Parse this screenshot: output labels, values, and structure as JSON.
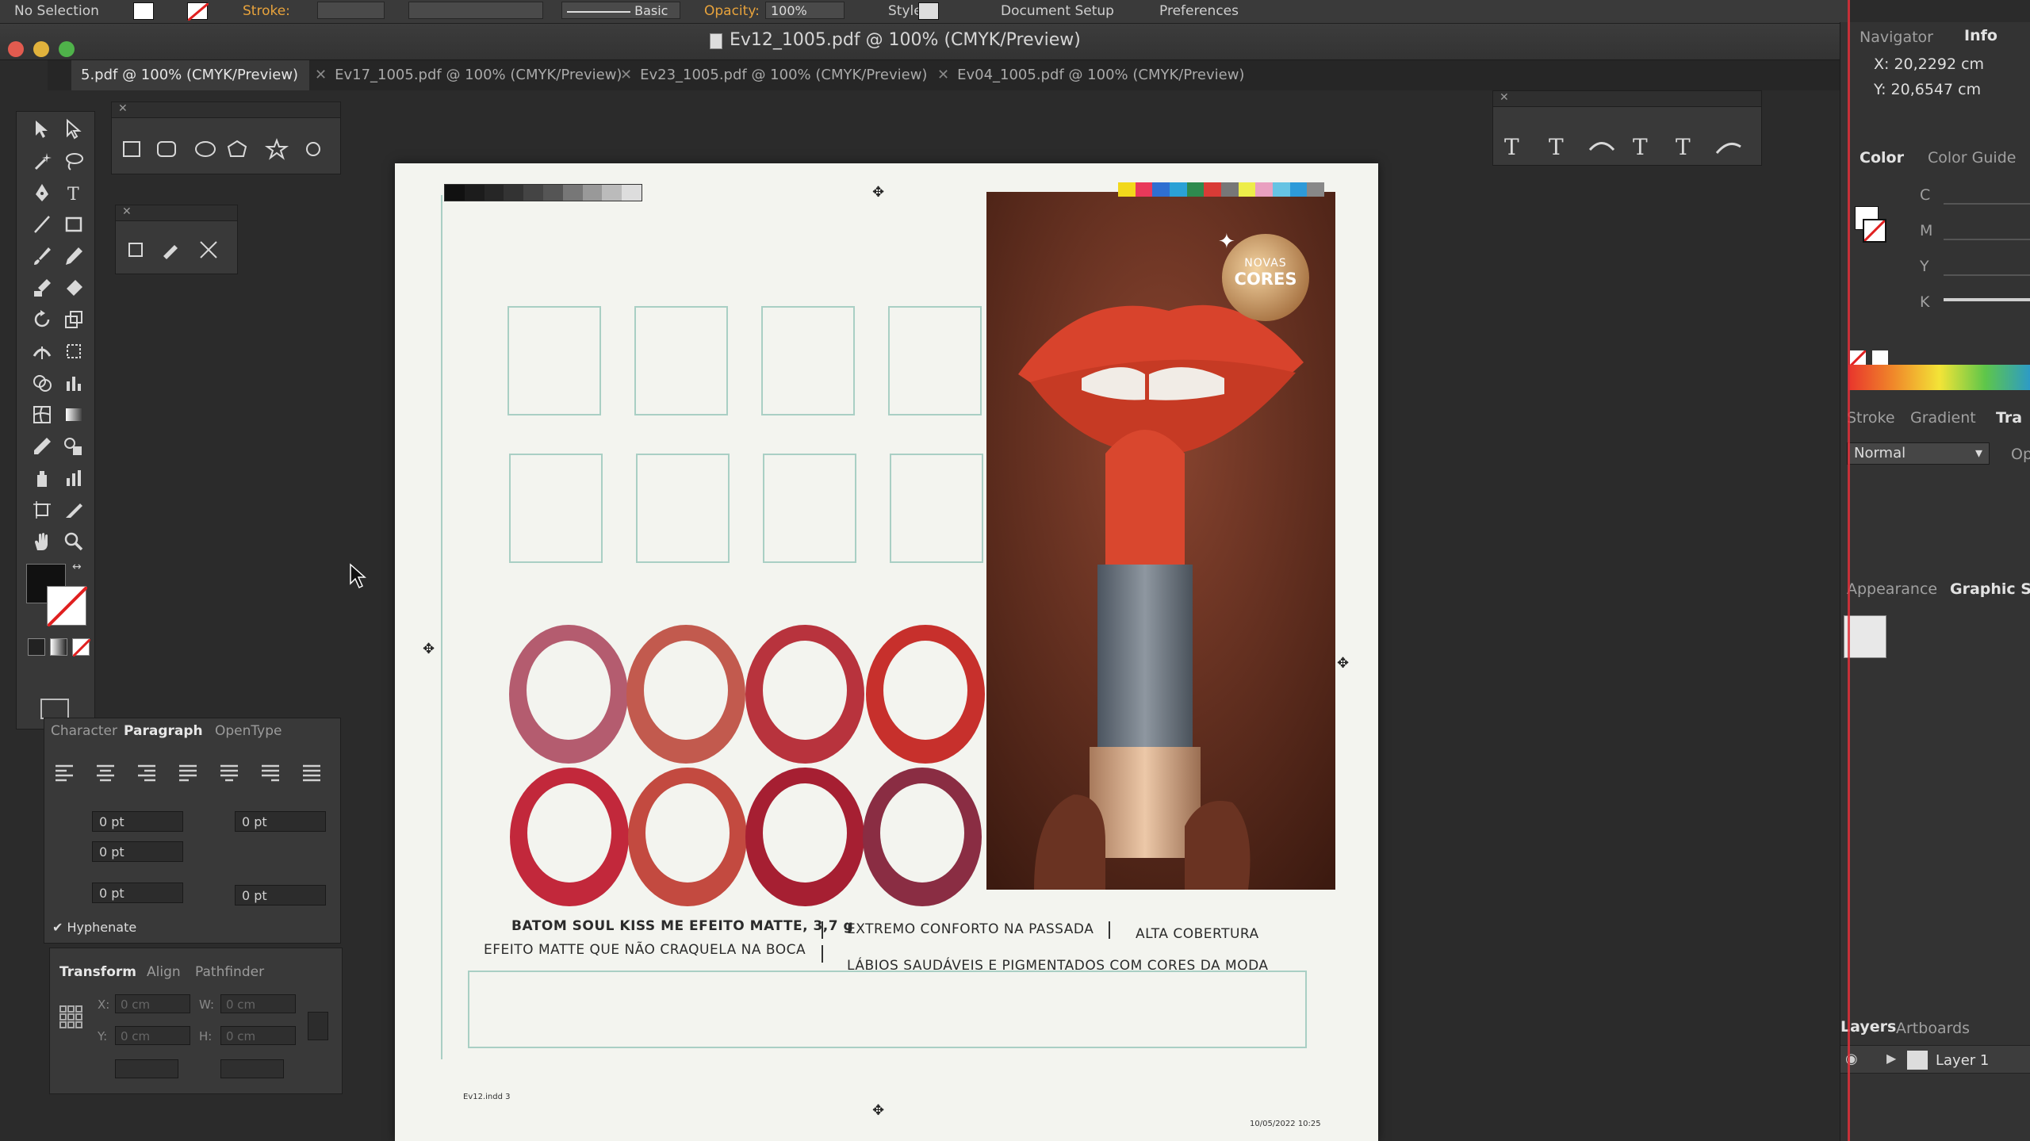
{
  "control_bar": {
    "selection": "No Selection",
    "stroke_label": "Stroke:",
    "brush": "Basic",
    "opacity_label": "Opacity:",
    "opacity_value": "100%",
    "style_label": "Style:",
    "document_setup": "Document Setup",
    "preferences": "Preferences"
  },
  "window": {
    "title": "Ev12_1005.pdf @ 100% (CMYK/Preview)"
  },
  "tabs": [
    {
      "label": "5.pdf @ 100% (CMYK/Preview)",
      "active": true
    },
    {
      "label": "Ev17_1005.pdf @ 100% (CMYK/Preview)",
      "active": false
    },
    {
      "label": "Ev23_1005.pdf @ 100% (CMYK/Preview)",
      "active": false
    },
    {
      "label": "Ev04_1005.pdf @ 100% (CMYK/Preview)",
      "active": false
    }
  ],
  "paragraph_panel": {
    "tabs": [
      "Character",
      "Paragraph",
      "OpenType"
    ],
    "active_tab": "Paragraph",
    "left_indent": "0 pt",
    "right_indent": "0 pt",
    "first_line_indent": "0 pt",
    "space_before": "0 pt",
    "space_after": "0 pt",
    "hyphenate_label": "Hyphenate"
  },
  "transform_panel": {
    "tabs": [
      "Transform",
      "Align",
      "Pathfinder"
    ],
    "active_tab": "Transform",
    "x_label": "X:",
    "y_label": "Y:",
    "w_label": "W:",
    "h_label": "H:",
    "x_value": "0 cm",
    "y_value": "0 cm",
    "w_value": "0 cm",
    "h_value": "0 cm"
  },
  "artboard": {
    "badge_line1": "NOVAS",
    "badge_line2": "CORES",
    "product_title": "BATOM SOUL KISS ME EFEITO MATTE, 3,7 g",
    "product_sub": "EFEITO MATTE QUE NÃO CRAQUELA NA BOCA",
    "benefit_1": "EXTREMO CONFORTO NA PASSADA",
    "benefit_2": "ALTA COBERTURA",
    "benefit_3": "LÁBIOS SAUDÁVEIS E PIGMENTADOS COM CORES DA MODA",
    "slug_left": "Ev12.indd 3",
    "slug_right": "10/05/2022 10:25",
    "ring_colors": [
      "#b45c6f",
      "#c25a4e",
      "#b8333d",
      "#c7302c",
      "#c2283b",
      "#c34a40",
      "#a61f32",
      "#8a2d43"
    ],
    "swatch_colors": [
      "#f2d81b",
      "#e9395a",
      "#2f6fd1",
      "#2aa1d6",
      "#2e8a4e",
      "#d93b36",
      "#777777",
      "#eded4a",
      "#e9a0c0",
      "#66c3e3",
      "#2d9ad9",
      "#888888"
    ]
  },
  "right_panels": {
    "navigator": "Navigator",
    "info": "Info",
    "x_coord": "X:  20,2292 cm",
    "y_coord": "Y:  20,6547 cm",
    "color": "Color",
    "color_guide": "Color Guide",
    "channels": [
      "C",
      "M",
      "Y",
      "K"
    ],
    "stroke": "Stroke",
    "gradient": "Gradient",
    "transparency": "Tra",
    "blend_mode": "Normal",
    "opacity_short": "Op",
    "appearance": "Appearance",
    "graphic_styles": "Graphic Sty",
    "layers": "Layers",
    "artboards": "Artboards",
    "layer_1": "Layer 1"
  }
}
